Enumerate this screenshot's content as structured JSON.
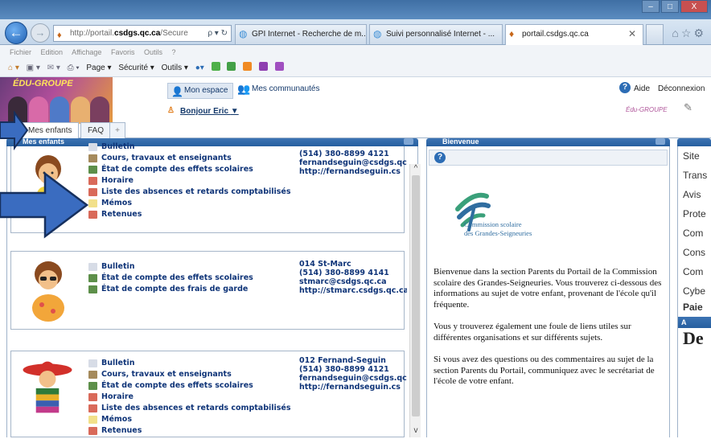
{
  "window": {
    "min": "–",
    "max": "□",
    "close": "X"
  },
  "address": {
    "prefix": "http://portail.",
    "domain": "csdgs.qc.ca",
    "suffix": "/Secure",
    "tools": "ρ ▾ ↻"
  },
  "tabs": [
    {
      "label": "GPI Internet - Recherche de m..."
    },
    {
      "label": "Suivi personnalisé Internet - ..."
    },
    {
      "label": "portail.csdgs.qc.ca",
      "close": "✕"
    }
  ],
  "menubar": [
    "Fichier",
    "Edition",
    "Affichage",
    "Favoris",
    "Outils",
    "?"
  ],
  "cmdbar": {
    "page": "Page ▾",
    "securite": "Sécurité ▾",
    "outils": "Outils ▾"
  },
  "portal": {
    "logo": "ÉDU-GROUPE",
    "mon_espace": "Mon espace",
    "mes_communautes": "Mes communautés",
    "bonjour": "Bonjour Eric",
    "aide": "Aide",
    "deconnexion": "Déconnexion",
    "edu_small": "Édu-GROUPE"
  },
  "nav": {
    "mes_enfants": "Mes enfants",
    "faq": "FAQ",
    "plus": "+"
  },
  "col1": {
    "title": "Mes enfants"
  },
  "children": [
    {
      "links": [
        "Bulletin",
        "Cours, travaux et enseignants",
        "État de compte des effets scolaires",
        "Horaire",
        "Liste des absences et retards comptabilisés",
        "Mémos",
        "Retenues"
      ],
      "contact": [
        "(514) 380-8899 4121",
        "fernandseguin@csdgs.qc",
        "http://fernandseguin.cs"
      ]
    },
    {
      "links": [
        "Bulletin",
        "État de compte des effets scolaires",
        "État de compte des frais de garde"
      ],
      "contact": [
        "014 St-Marc",
        "(514) 380-8899 4141",
        "stmarc@csdgs.qc.ca",
        "http://stmarc.csdgs.qc.ca"
      ]
    },
    {
      "links": [
        "Bulletin",
        "Cours, travaux et enseignants",
        "État de compte des effets scolaires",
        "Horaire",
        "Liste des absences et retards comptabilisés",
        "Mémos",
        "Retenues"
      ],
      "contact": [
        "012 Fernand-Seguin",
        "(514) 380-8899 4121",
        "fernandseguin@csdgs.qc",
        "http://fernandseguin.cs"
      ]
    }
  ],
  "col2": {
    "title": "Bienvenue",
    "help": "?",
    "cssgs_name_1": "Commission scolaire",
    "cssgs_name_2": "des Grandes-Seigneuries",
    "welcome": [
      "Bienvenue dans la section Parents du Portail de la Commission scolaire des Grandes-Seigneuries. Vous trouverez ci-dessous des informations au sujet de votre enfant, provenant de l'école qu'il fréquente.",
      "Vous y trouverez également une foule de liens utiles sur différentes organisations et sur différents sujets.",
      "Si vous avez des questions ou des commentaires au sujet de la section Parents du Portail, communiquez avec le secrétariat de l'école de votre enfant."
    ]
  },
  "col3": {
    "items": [
      "Site",
      "Trans",
      "Avis",
      "Prote",
      "Com",
      "Cons",
      "Com",
      "Cybe"
    ],
    "bold_item": "Paie",
    "head2": "A",
    "dev": "De"
  },
  "colors": {
    "link": "#0f3478",
    "header_blue": "#275f9f",
    "arrow": "#3a6cc0"
  }
}
